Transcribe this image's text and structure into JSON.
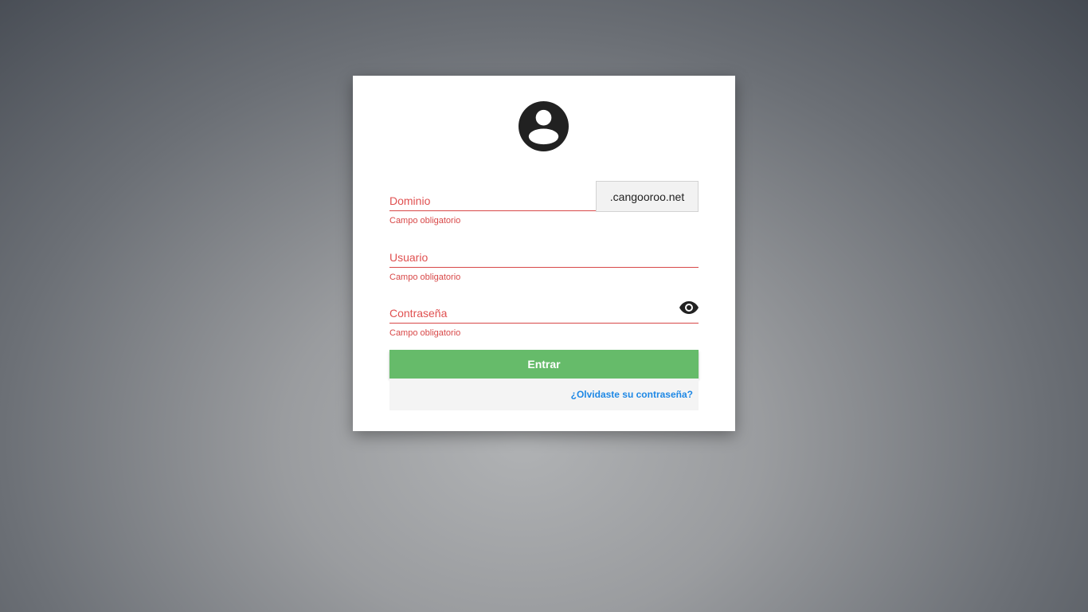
{
  "form": {
    "domain": {
      "label": "Dominio",
      "suffix": ".cangooroo.net",
      "error": "Campo obligatorio"
    },
    "username": {
      "label": "Usuario",
      "error": "Campo obligatorio"
    },
    "password": {
      "label": "Contraseña",
      "error": "Campo obligatorio"
    },
    "submit_label": "Entrar",
    "forgot_label": "¿Olvidaste su contraseña?"
  },
  "icons": {
    "avatar": "account-circle-icon",
    "password_toggle": "eye-icon"
  },
  "colors": {
    "error": "#e05050",
    "submit": "#66bb6a",
    "link": "#1e88e5"
  }
}
